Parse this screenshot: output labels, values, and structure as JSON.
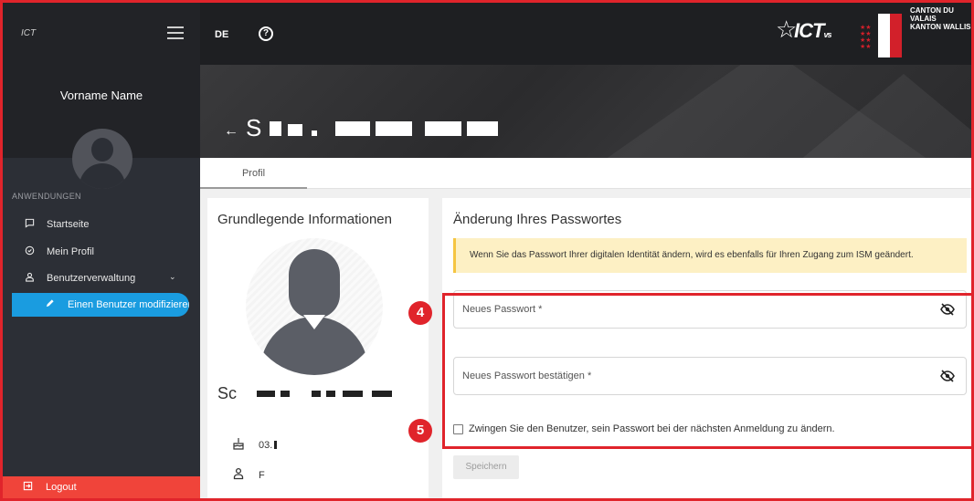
{
  "sidebar": {
    "logo_text": "ICT",
    "username": "Vorname Name",
    "section_label": "ANWENDUNGEN",
    "items": [
      {
        "label": "Startseite",
        "icon": "message-square-icon"
      },
      {
        "label": "Mein Profil",
        "icon": "shield-check-icon"
      },
      {
        "label": "Benutzerverwaltung",
        "icon": "user-icon"
      }
    ],
    "active_item": {
      "label": "Einen Benutzer modifizieren",
      "icon": "pencil-icon"
    },
    "logout_label": "Logout"
  },
  "topbar": {
    "language": "DE",
    "help_glyph": "?",
    "brand_logo": "ICT",
    "brand_logo_suffix": "vs",
    "canton_line1": "CANTON DU VALAIS",
    "canton_line2": "KANTON WALLIS"
  },
  "header": {
    "back_glyph": "←",
    "title_visible": "S"
  },
  "tabs": [
    {
      "label": "Profil",
      "active": true
    }
  ],
  "basic_info": {
    "title": "Grundlegende Informationen",
    "name_visible": "Sc",
    "birthdate_visible": "03.",
    "gender_visible": "F"
  },
  "password_form": {
    "title": "Änderung Ihres Passwortes",
    "notice": "Wenn Sie das Passwort Ihrer digitalen Identität ändern, wird es ebenfalls für Ihren Zugang zum ISM geändert.",
    "new_password_placeholder": "Neues Passwort *",
    "confirm_password_placeholder": "Neues Passwort bestätigen *",
    "force_change_label": "Zwingen Sie den Benutzer, sein Passwort bei der nächsten Anmeldung zu ändern.",
    "force_change_checked": false,
    "save_label": "Speichern"
  },
  "annotations": {
    "badge_password_fields": "4",
    "badge_checkbox": "5",
    "highlight_color": "#e0242b"
  },
  "colors": {
    "accent": "#1a9ce0",
    "logout": "#f0443a",
    "notice_bg": "#fdf0c4"
  }
}
